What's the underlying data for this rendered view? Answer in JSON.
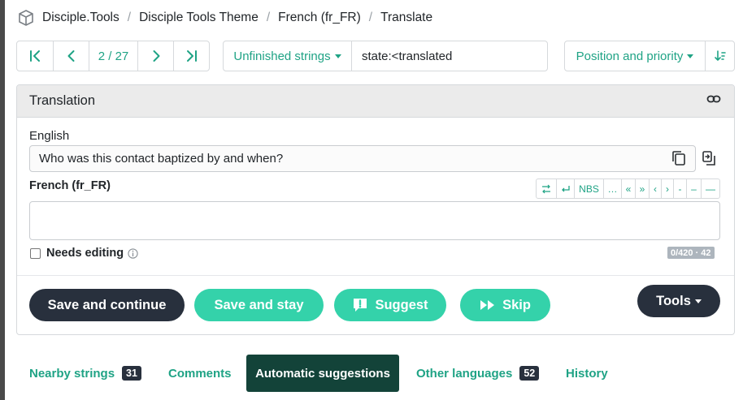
{
  "breadcrumb": {
    "items": [
      "Disciple.Tools",
      "Disciple Tools Theme",
      "French (fr_FR)",
      "Translate"
    ],
    "separator": "/"
  },
  "toolbar": {
    "pager": "2 / 27",
    "filter_label": "Unfinished strings",
    "filter_query": "state:<translated",
    "sort_label": "Position and priority"
  },
  "translation": {
    "header": "Translation",
    "source_lang": "English",
    "source_text": "Who was this contact baptized by and when?",
    "target_lang": "French (fr_FR)",
    "target_text": "",
    "char_buttons": [
      "NBS",
      "…",
      "«",
      "»",
      "‹",
      "›",
      "-",
      "–",
      "—"
    ],
    "needs_editing": "Needs editing",
    "counter": "0/420 · 42"
  },
  "actions": {
    "save_continue": "Save and continue",
    "save_stay": "Save and stay",
    "suggest": "Suggest",
    "skip": "Skip",
    "tools": "Tools"
  },
  "tabs": {
    "nearby": {
      "label": "Nearby strings",
      "count": "31"
    },
    "comments": {
      "label": "Comments"
    },
    "automatic": {
      "label": "Automatic suggestions"
    },
    "other": {
      "label": "Other languages",
      "count": "52"
    },
    "history": {
      "label": "History"
    }
  },
  "colors": {
    "accent": "#1fa385",
    "button_teal": "#34d2aa",
    "button_dark": "#28303d",
    "active_tab": "#134339"
  },
  "icons": [
    "weblate-logo-icon",
    "first-icon",
    "prev-icon",
    "next-icon",
    "last-icon",
    "sort-direction-icon",
    "link-icon",
    "copy-icon",
    "clone-icon",
    "info-icon",
    "suggest-icon",
    "skip-icon"
  ]
}
